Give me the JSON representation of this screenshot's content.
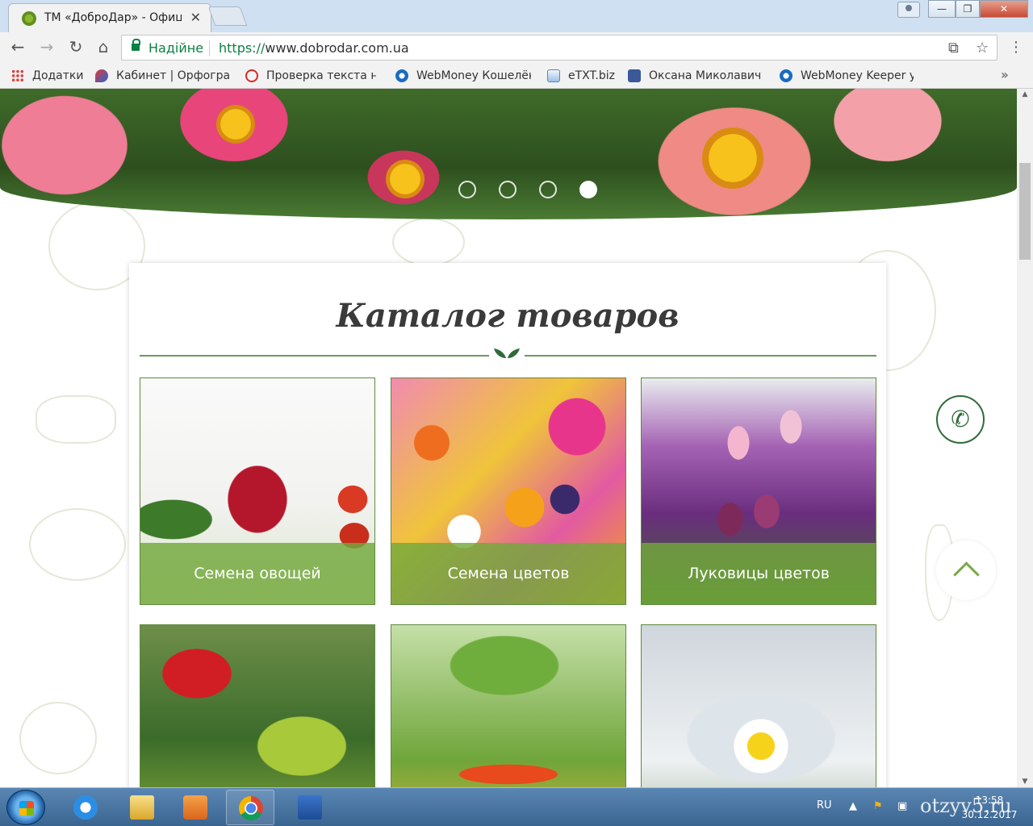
{
  "browser": {
    "tab_title": "ТМ «ДоброДар» - Офиц",
    "security_label": "Надійне",
    "url_scheme": "https://",
    "url_host": "www.dobrodar.com.ua",
    "bookmarks": [
      {
        "label": "Додатки",
        "icon": "apps-grid-icon"
      },
      {
        "label": "Кабинет | Орфограм",
        "icon": "orfogrammka-icon"
      },
      {
        "label": "Проверка текста на",
        "icon": "copyright-icon"
      },
      {
        "label": "WebMoney Кошелёк",
        "icon": "webmoney-icon"
      },
      {
        "label": "eTXT.biz",
        "icon": "etxt-icon"
      },
      {
        "label": "Оксана Миколавичу",
        "icon": "facebook-icon"
      },
      {
        "label": "WebMoney Keeper у",
        "icon": "webmoney-icon"
      }
    ]
  },
  "page": {
    "catalog_title": "Каталог товаров",
    "slider_dots": 4,
    "slider_active_index": 3,
    "categories": [
      {
        "label": "Семена овощей"
      },
      {
        "label": "Семена цветов"
      },
      {
        "label": "Луковицы цветов"
      },
      {
        "label": ""
      },
      {
        "label": ""
      },
      {
        "label": ""
      }
    ]
  },
  "taskbar": {
    "language": "RU",
    "time": "13:58",
    "date": "30.12.2017",
    "watermark": "otzyv5.ru"
  }
}
